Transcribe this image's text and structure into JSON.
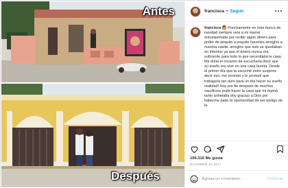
{
  "photo": {
    "before_label": "Antes",
    "after_label": "Después"
  },
  "post": {
    "username": "francisca",
    "separator": "•",
    "follow_label": "Seguir",
    "caption_user": "francisca",
    "caption_icon": "woman-emoji",
    "caption_text": "Precisamente en esta época de navidad siempre veía a mi mamá entusiasmada por recibir algún dinero para poder de poquito a poquito hacerles arreglos a nuestra casita. arreglos que solo se quedaban en intentos ya que el dinero nunca era suficiente para todo lo que necesitaba la casa. Me dolía el corazón de escucharla decir que su sueño era vivir en una casa bonita. Desde el primer día que la escuché entre suspiros decir eso, me prometí y le prometí que trabajaría tan duro para un día hacer su sueño realidad! Hoy por fin después de muchos sacrificios pude hacer la casa que mi mamá tanto anhelaba doy gracias a Dios por haberme dado la oportunidad de ser testigo de la"
  },
  "stats": {
    "likes": "195.316 Me gusta",
    "date": "DICIEMBRE 20, 2017"
  },
  "comment": {
    "placeholder": "Agrega un comentario...",
    "post_label": "Publicar"
  },
  "colors": {
    "accent": "#0095f6",
    "post_disabled": "#b3dffc",
    "border": "#dbdbdb"
  }
}
